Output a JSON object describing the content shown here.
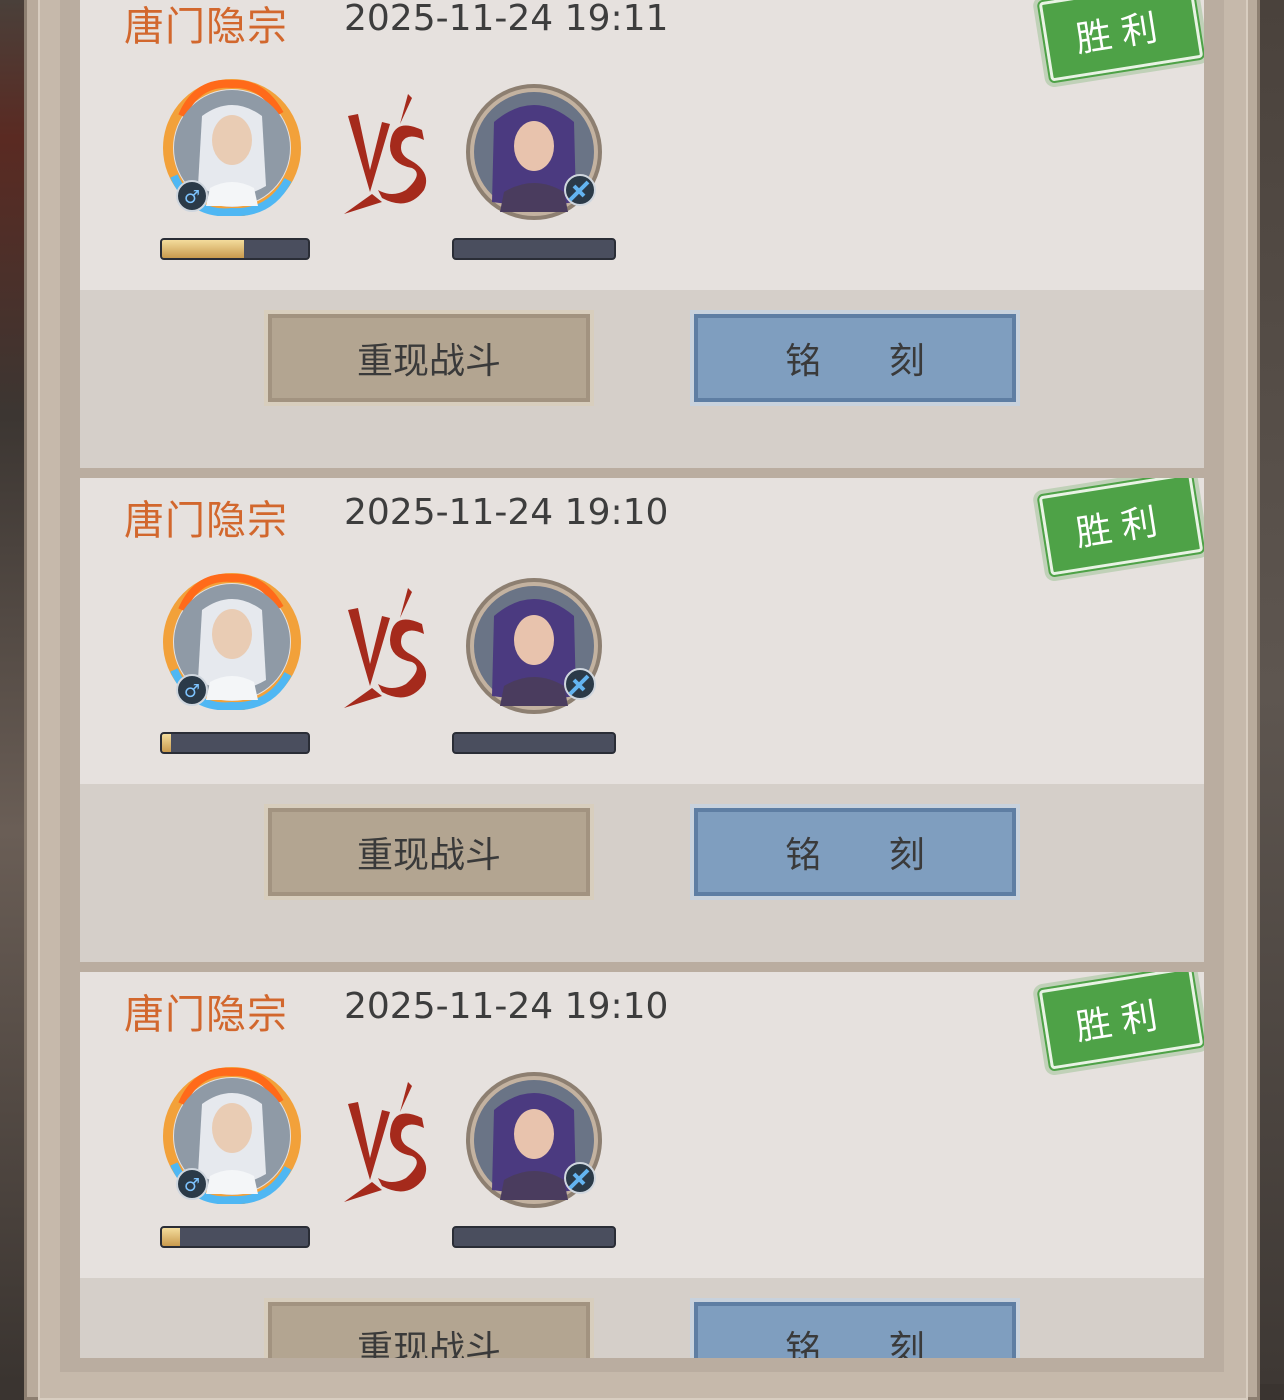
{
  "records": [
    {
      "sect": "唐门隐宗",
      "time": "2025-11-24 19:11",
      "result": "胜利",
      "vs_label": "VS",
      "player_gender": "♂",
      "progress": 0.56,
      "replay_label": "重现战斗",
      "engrave_label": "铭 刻"
    },
    {
      "sect": "唐门隐宗",
      "time": "2025-11-24 19:10",
      "result": "胜利",
      "vs_label": "VS",
      "player_gender": "♂",
      "progress": 0.06,
      "replay_label": "重现战斗",
      "engrave_label": "铭 刻"
    },
    {
      "sect": "唐门隐宗",
      "time": "2025-11-24 19:10",
      "result": "胜利",
      "vs_label": "VS",
      "player_gender": "♂",
      "progress": 0.12,
      "replay_label": "重现战斗",
      "engrave_label": "铭 刻"
    }
  ],
  "colors": {
    "sect": "#d2672d",
    "victory_stamp": "#4ea247",
    "replay_button": "#b3a591",
    "engrave_button": "#7f9ebf",
    "progress_fill": "#c99a4e"
  },
  "icons": [
    "male-gender-icon",
    "weapon-badge-icon",
    "fire-ring-frame-icon",
    "vs-brush-icon"
  ]
}
